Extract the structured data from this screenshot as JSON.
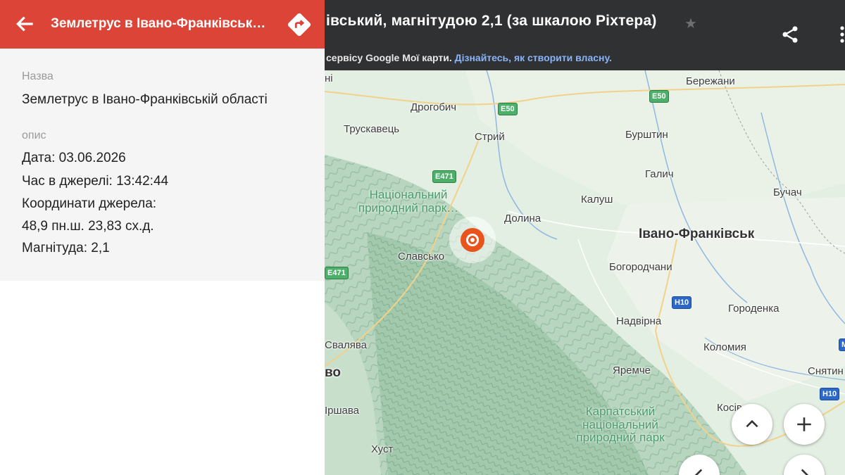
{
  "topbar": {
    "map_title": "івський, магнітудою 2,1 (за шкалою Ріхтера)",
    "subtitle_text": "сервісу Google Мої карти.",
    "subtitle_link": "Дізнайтесь, як створити власну."
  },
  "panel": {
    "title": "Землетрус в Івано-Франківськ…",
    "name_label": "Назва",
    "name_value": "Землетрус в Івано-Франківській  області",
    "desc_label": "опис",
    "date": "Дата: 03.06.2026",
    "time": "Час в джерелі: 13:42:44",
    "coords_label": "Координати джерела:",
    "coords_value": "48,9 пн.ш. 23,83 сх.д.",
    "magnitude": "Магнітуда: 2,1"
  },
  "map": {
    "places": {
      "berezhany": "Бережани",
      "drohobych": "Дрогобич",
      "truskavets": "Трускавець",
      "stryi": "Стрий",
      "burshtyn": "Бурштин",
      "halych": "Галич",
      "kalush": "Калуш",
      "buchach": "Бучач",
      "dolyna": "Долина",
      "ivano_frankivsk": "Івано-Франківськ",
      "slavske": "Славсько",
      "bohorodchany": "Богородчани",
      "horodenka": "Городенка",
      "nadvirna": "Надвірна",
      "kolomyia": "Коломия",
      "svaliava": "Свалява",
      "yaremche": "Яремче",
      "sniatyn": "Снятин",
      "irshava": "Іршава",
      "khust": "Хуст",
      "kosiv": "Косів",
      "edge_ni": "ні",
      "edge_vo": "во"
    },
    "parks": {
      "national_park": "Національний природний парк…",
      "carpathian_park": "Карпатський національний природний парк"
    },
    "roads": {
      "e50_a": "E50",
      "e50_b": "E50",
      "e471_a": "E471",
      "e471_b": "E471",
      "h10_a": "H10",
      "h10_b": "H10",
      "m_edge": "M"
    }
  },
  "colors": {
    "header_red": "#db4437",
    "marker_orange": "#e8541c",
    "topbar": "#303133"
  },
  "icons": [
    "back-arrow-icon",
    "directions-icon",
    "star-icon",
    "share-icon",
    "more-vert-icon",
    "earthquake-marker-icon",
    "chevron-up-icon",
    "plus-icon",
    "chevron-left-icon",
    "chevron-right-icon"
  ]
}
